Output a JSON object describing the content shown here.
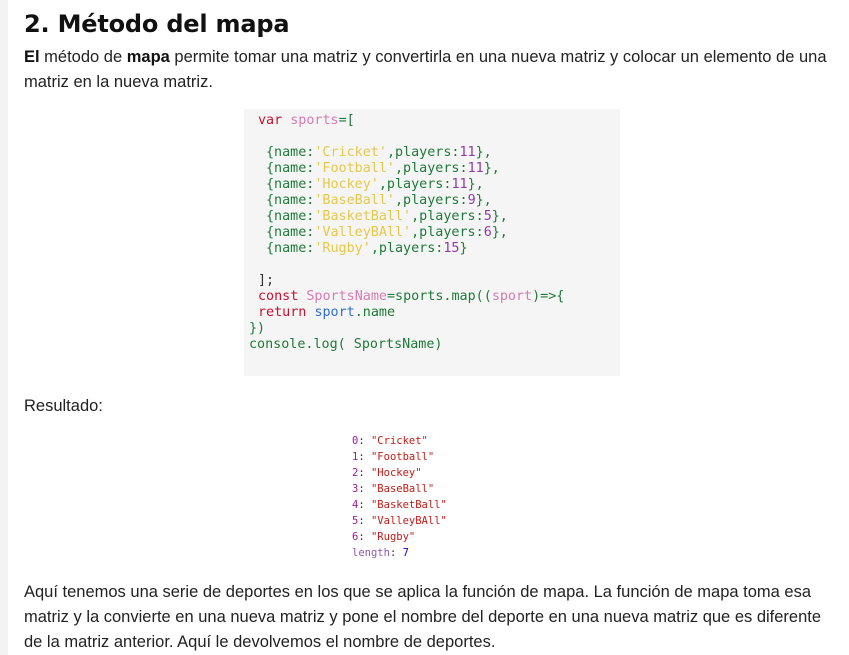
{
  "heading": "2. Método del mapa",
  "intro": {
    "bold1": "El",
    "text1": " método de ",
    "bold2": "mapa",
    "text2": " permite tomar una matriz y convertirla en una nueva matriz y colocar un elemento de una matriz en la nueva matriz."
  },
  "code": {
    "lines": [
      [
        {
          "t": "var ",
          "c": "kw"
        },
        {
          "t": "sports",
          "c": "id"
        },
        {
          "t": "=[",
          "c": "pr"
        }
      ],
      [],
      [
        {
          "t": "{name:",
          "c": "pr"
        },
        {
          "t": "'Cricket'",
          "c": "st"
        },
        {
          "t": ",players:",
          "c": "pr"
        },
        {
          "t": "11",
          "c": "nu"
        },
        {
          "t": "},",
          "c": "pr"
        }
      ],
      [
        {
          "t": "{name:",
          "c": "pr"
        },
        {
          "t": "'Football'",
          "c": "st"
        },
        {
          "t": ",players:",
          "c": "pr"
        },
        {
          "t": "11",
          "c": "nu"
        },
        {
          "t": "},",
          "c": "pr"
        }
      ],
      [
        {
          "t": "{name:",
          "c": "pr"
        },
        {
          "t": "'Hockey'",
          "c": "st"
        },
        {
          "t": ",players:",
          "c": "pr"
        },
        {
          "t": "11",
          "c": "nu"
        },
        {
          "t": "},",
          "c": "pr"
        }
      ],
      [
        {
          "t": "{name:",
          "c": "pr"
        },
        {
          "t": "'BaseBall'",
          "c": "st"
        },
        {
          "t": ",players:",
          "c": "pr"
        },
        {
          "t": "9",
          "c": "nu"
        },
        {
          "t": "},",
          "c": "pr"
        }
      ],
      [
        {
          "t": "{name:",
          "c": "pr"
        },
        {
          "t": "'BasketBall'",
          "c": "st"
        },
        {
          "t": ",players:",
          "c": "pr"
        },
        {
          "t": "5",
          "c": "nu"
        },
        {
          "t": "},",
          "c": "pr"
        }
      ],
      [
        {
          "t": "{name:",
          "c": "pr"
        },
        {
          "t": "'ValleyBAll'",
          "c": "st"
        },
        {
          "t": ",players:",
          "c": "pr"
        },
        {
          "t": "6",
          "c": "nu"
        },
        {
          "t": "},",
          "c": "pr"
        }
      ],
      [
        {
          "t": "{name:",
          "c": "pr"
        },
        {
          "t": "'Rugby'",
          "c": "st"
        },
        {
          "t": ",players:",
          "c": "pr"
        },
        {
          "t": "15",
          "c": "nu"
        },
        {
          "t": "}",
          "c": "pr"
        }
      ],
      [],
      [
        {
          "t": "];",
          "c": "pl"
        }
      ],
      [
        {
          "t": "const ",
          "c": "kw"
        },
        {
          "t": "SportsName",
          "c": "id"
        },
        {
          "t": "=sports.map((",
          "c": "pr"
        },
        {
          "t": "sport",
          "c": "id"
        },
        {
          "t": ")=>{",
          "c": "pr"
        }
      ],
      [
        {
          "t": "return ",
          "c": "kw"
        },
        {
          "t": "sport",
          "c": "bl"
        },
        {
          "t": ".name",
          "c": "pr"
        }
      ],
      [
        {
          "t": "})",
          "c": "pr"
        }
      ],
      [
        {
          "t": "console.log( SportsName)",
          "c": "pr"
        }
      ]
    ]
  },
  "result_label": "Resultado:",
  "console": {
    "items": [
      {
        "index": "0",
        "value": "\"Cricket\""
      },
      {
        "index": "1",
        "value": "\"Football\""
      },
      {
        "index": "2",
        "value": "\"Hockey\""
      },
      {
        "index": "3",
        "value": "\"BaseBall\""
      },
      {
        "index": "4",
        "value": "\"BasketBall\""
      },
      {
        "index": "5",
        "value": "\"ValleyBAll\""
      },
      {
        "index": "6",
        "value": "\"Rugby\""
      }
    ],
    "length_label": "length",
    "length_value": "7"
  },
  "outro": "Aquí tenemos una serie de deportes en los que se aplica la función de mapa. La función de mapa toma esa matriz y la convierte en una nueva matriz y pone el nombre del deporte en una nueva matriz que es diferente de la matriz anterior. Aquí le devolvemos el nombre de deportes."
}
